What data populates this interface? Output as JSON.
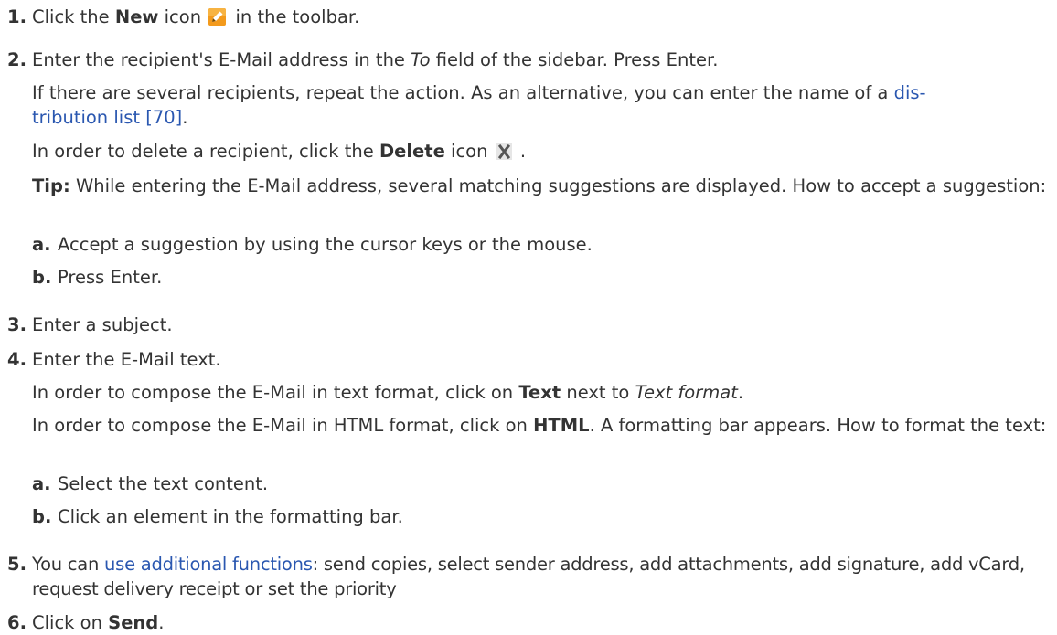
{
  "steps": [
    {
      "num": "1.",
      "a": "Click the ",
      "b": "New",
      "c": " icon",
      "d": " in the toolbar."
    },
    {
      "num": "2.",
      "a": "Enter the recipient's E-Mail address in the ",
      "b": "To",
      "c": " field of the sidebar. Press Enter.",
      "p1a": "If there are several recipients, repeat the action. As an alternative, you can enter the name of a ",
      "p1link": "dis-tribution list [70]",
      "p1b": ".",
      "p2a": "In order to delete a recipient, click the ",
      "p2b": "Delete",
      "p2c": " icon",
      "p2d": " .",
      "tipLabel": "Tip:",
      "tipText": " While entering the E-Mail address, several matching suggestions are displayed. How to accept a suggestion:",
      "subs": [
        {
          "letter": "a.",
          "text": "Accept a suggestion by using the cursor keys or the mouse."
        },
        {
          "letter": "b.",
          "text": "Press Enter."
        }
      ]
    },
    {
      "num": "3.",
      "text": "Enter a subject."
    },
    {
      "num": "4.",
      "text": "Enter the E-Mail text.",
      "p1a": "In order to compose the E-Mail in text format, click on ",
      "p1b": "Text",
      "p1c": " next to ",
      "p1d": "Text format",
      "p1e": ".",
      "p2a": "In order to compose the E-Mail in HTML format, click on ",
      "p2b": "HTML",
      "p2c": ". A formatting bar appears. How to format the text:",
      "subs": [
        {
          "letter": "a.",
          "text": "Select the text content."
        },
        {
          "letter": "b.",
          "text": "Click an element in the formatting bar."
        }
      ]
    },
    {
      "num": "5.",
      "a": "You can ",
      "link": "use additional functions",
      "b": ": send copies, select sender address, add attachments, add signature, add vCard, request delivery receipt or set the priority"
    },
    {
      "num": "6.",
      "a": "Click on ",
      "b": "Send",
      "c": "."
    }
  ],
  "colors": {
    "text": "#333333",
    "link": "#2a57b0"
  },
  "icons": {
    "new": "new-icon (pencil on orange square)",
    "delete": "delete-icon (grey X)"
  }
}
